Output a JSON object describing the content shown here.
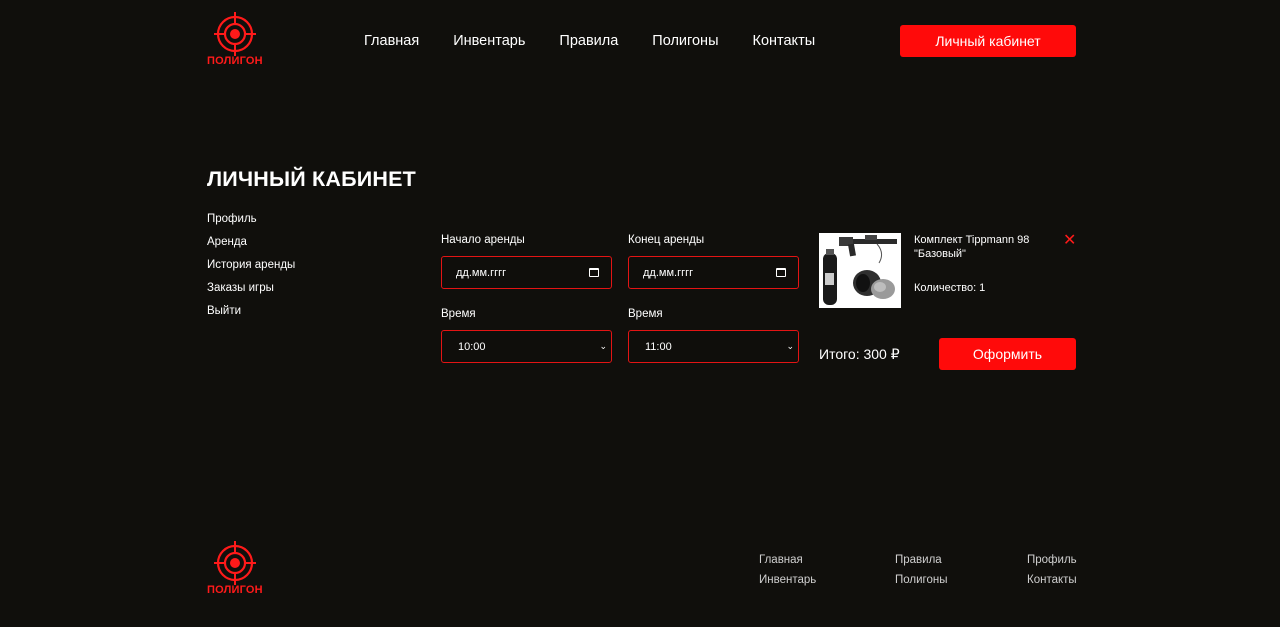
{
  "brand": {
    "logo_text": "ПОЛИГОН",
    "accent": "#ff0a0a",
    "background": "#100f0c"
  },
  "nav": {
    "items": [
      "Главная",
      "Инвентарь",
      "Правила",
      "Полигоны",
      "Контакты"
    ],
    "cabinet_button": "Личный кабинет"
  },
  "page": {
    "title": "ЛИЧНЫЙ КАБИНЕТ"
  },
  "side_menu": [
    "Профиль",
    "Аренда",
    "История аренды",
    "Заказы игры",
    "Выйти"
  ],
  "rental_form": {
    "start_label": "Начало аренды",
    "start_value": "дд.мм.гггг",
    "end_label": "Конец аренды",
    "end_value": "дд.мм.гггг",
    "start_time_label": "Время",
    "start_time_value": "10:00",
    "end_time_label": "Время",
    "end_time_value": "11:00"
  },
  "cart": {
    "item_name": "Комплект Tippmann 98 \"Базовый\"",
    "quantity": "Количество: 1",
    "total": "Итого: 300 ₽",
    "checkout_button": "Оформить",
    "remove_icon": "close-icon"
  },
  "footer": {
    "col1": [
      "Главная",
      "Инвентарь"
    ],
    "col2": [
      "Правила",
      "Полигоны"
    ],
    "col3": [
      "Профиль",
      "Контакты"
    ]
  }
}
